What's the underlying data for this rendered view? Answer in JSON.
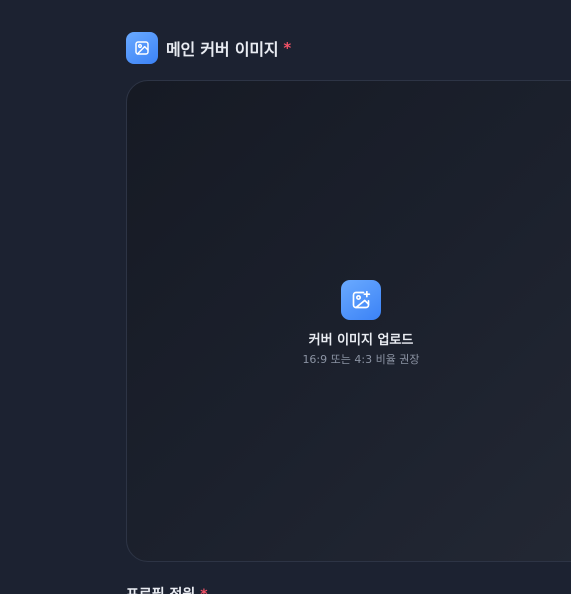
{
  "cover_section": {
    "title": "메인 커버 이미지",
    "required_mark": "*",
    "icon": "image-icon"
  },
  "upload": {
    "title": "커버 이미지 업로드",
    "hint": "16:9 또는 4:3 비율 권장",
    "icon": "image-plus-icon"
  },
  "next_section": {
    "title": "프로필 정원",
    "required_mark": "*"
  },
  "colors": {
    "background": "#1c2231",
    "accent": "#3b82f6",
    "required": "#f25267"
  }
}
